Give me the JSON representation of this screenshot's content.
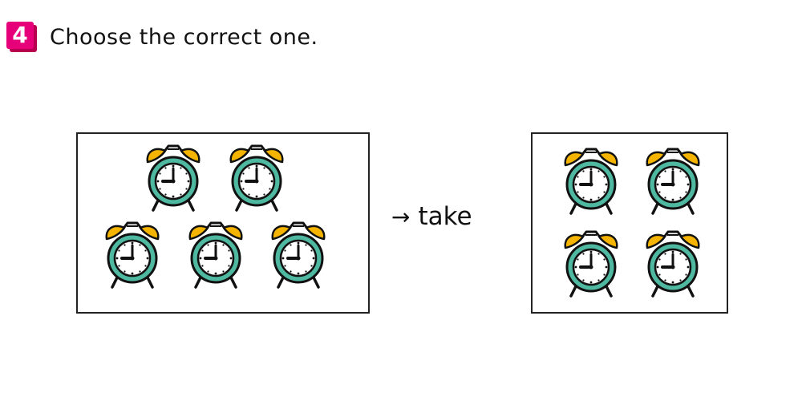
{
  "question": {
    "number": "4",
    "prompt": "Choose the correct one."
  },
  "operation": {
    "arrow": "→",
    "label": "take"
  },
  "groups": {
    "before": {
      "count": 5,
      "icon": "alarm-clock-icon"
    },
    "after": {
      "count": 4,
      "icon": "alarm-clock-icon"
    }
  },
  "colors": {
    "badge": "#e6007a",
    "clock_body": "#4fb8a0",
    "bells": "#f5b400",
    "outline": "#111111"
  }
}
